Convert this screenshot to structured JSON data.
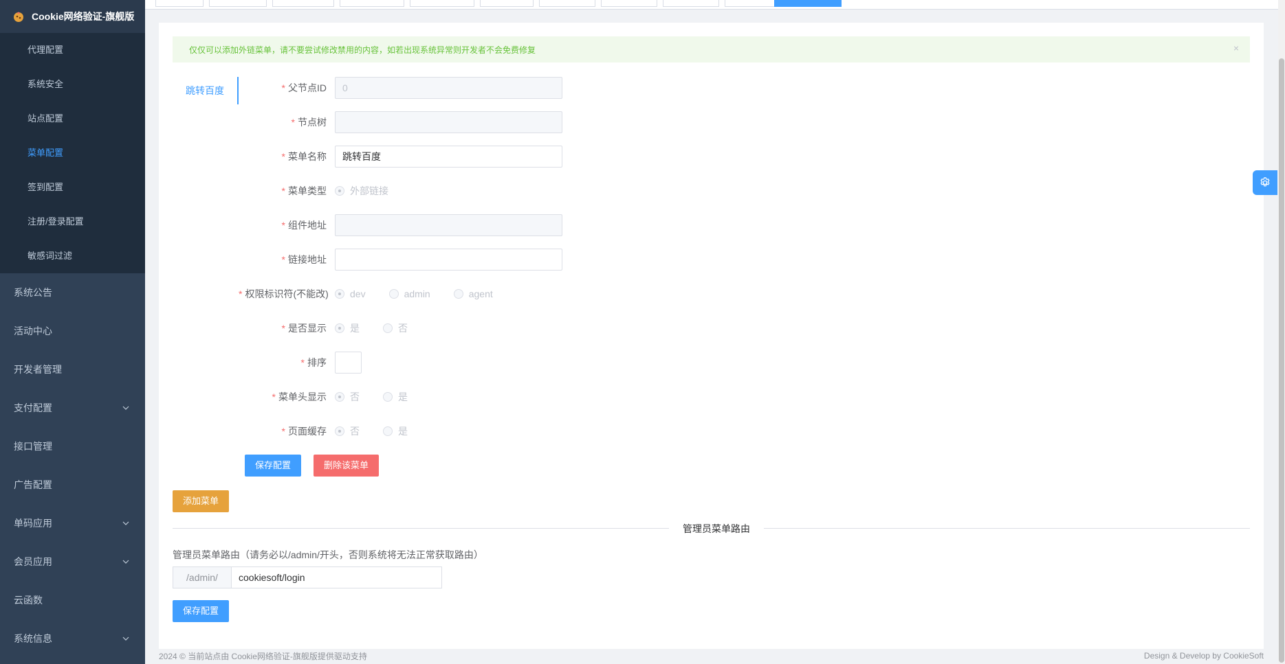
{
  "sidebar": {
    "brand": "Cookie网络验证-旗舰版",
    "sub_items": [
      "代理配置",
      "系统安全",
      "站点配置",
      "菜单配置",
      "签到配置",
      "注册/登录配置",
      "敏感词过滤"
    ],
    "active_sub_index": 3,
    "items": [
      {
        "label": "系统公告",
        "has_children": false
      },
      {
        "label": "活动中心",
        "has_children": false
      },
      {
        "label": "开发者管理",
        "has_children": false
      },
      {
        "label": "支付配置",
        "has_children": true
      },
      {
        "label": "接口管理",
        "has_children": false
      },
      {
        "label": "广告配置",
        "has_children": false
      },
      {
        "label": "单码应用",
        "has_children": true
      },
      {
        "label": "会员应用",
        "has_children": true
      },
      {
        "label": "云函数",
        "has_children": false
      },
      {
        "label": "系统信息",
        "has_children": true
      }
    ]
  },
  "alert": {
    "text": "仅仅可以添加外链菜单，请不要尝试修改禁用的内容，如若出现系统异常则开发者不会免费修复",
    "close": "×"
  },
  "menu_tab": "跳转百度",
  "form": {
    "parent_id": {
      "label": "父节点ID",
      "value": "0"
    },
    "node_tree": {
      "label": "节点树",
      "value": ""
    },
    "menu_name": {
      "label": "菜单名称",
      "value": "跳转百度"
    },
    "menu_type": {
      "label": "菜单类型",
      "options": [
        "外部链接"
      ],
      "selected": 0
    },
    "component_path": {
      "label": "组件地址",
      "value": ""
    },
    "link_url": {
      "label": "链接地址",
      "value": ""
    },
    "permission": {
      "label": "权限标识符(不能改)",
      "options": [
        "dev",
        "admin",
        "agent"
      ],
      "selected": 0
    },
    "visible": {
      "label": "是否显示",
      "options": [
        "是",
        "否"
      ],
      "selected": 0
    },
    "sort": {
      "label": "排序",
      "value": ""
    },
    "header_visible": {
      "label": "菜单头显示",
      "options": [
        "否",
        "是"
      ],
      "selected": 0
    },
    "page_cache": {
      "label": "页面缓存",
      "options": [
        "否",
        "是"
      ],
      "selected": 0
    },
    "save_label": "保存配置",
    "delete_label": "删除该菜单"
  },
  "add_menu_label": "添加菜单",
  "admin_route": {
    "divider": "管理员菜单路由",
    "label": "管理员菜单路由（请务必以/admin/开头，否则系统将无法正常获取路由）",
    "prefix": "/admin/",
    "value": "cookiesoft/login",
    "save_label": "保存配置"
  },
  "footer": {
    "left": "2024 © 当前站点由 Cookie网络验证-旗舰版提供驱动支持",
    "right": "Design & Develop by CookieSoft"
  },
  "colors": {
    "primary": "#409eff",
    "danger": "#f56c6c",
    "warning": "#e6a23c",
    "sidebar_bg": "#304156",
    "alert_bg": "#f0f9eb"
  }
}
